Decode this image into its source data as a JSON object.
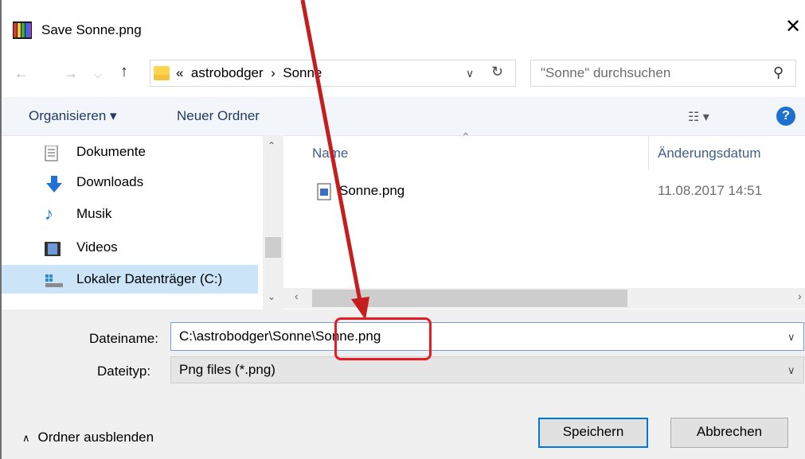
{
  "window": {
    "title": "Save Sonne.png",
    "close_icon": "close-icon"
  },
  "nav": {
    "back_icon": "arrow-left-icon",
    "forward_icon": "arrow-right-icon",
    "recent_icon": "chevron-down-icon",
    "up_icon": "arrow-up-icon",
    "address": {
      "prefix": "«",
      "path": [
        "astrobodger",
        "Sonne"
      ],
      "separator": "›"
    },
    "search_placeholder": "\"Sonne\" durchsuchen"
  },
  "toolbar": {
    "organize_label": "Organisieren ▾",
    "new_folder_label": "Neuer Ordner",
    "view_icon": "view-options-icon",
    "help_label": "?"
  },
  "sidebar": {
    "items": [
      {
        "label": "Dokumente",
        "icon": "documents-icon"
      },
      {
        "label": "Downloads",
        "icon": "downloads-icon"
      },
      {
        "label": "Musik",
        "icon": "music-icon"
      },
      {
        "label": "Videos",
        "icon": "videos-icon"
      },
      {
        "label": "Lokaler Datenträger (C:)",
        "icon": "drive-icon",
        "selected": true
      }
    ]
  },
  "file_list": {
    "columns": [
      "Name",
      "Änderungsdatum"
    ],
    "rows": [
      {
        "name": "Sonne.png",
        "modified": "11.08.2017 14:51",
        "icon": "png-file-icon"
      }
    ]
  },
  "form": {
    "filename_label": "Dateiname:",
    "filename_value": "C:\\astrobodger\\Sonne\\Sonne.png",
    "filetype_label": "Dateityp:",
    "filetype_value": "Png files (*.png)"
  },
  "footer": {
    "hide_folders_label": "Ordner ausblenden",
    "save_label": "Speichern",
    "cancel_label": "Abbrechen"
  },
  "annotation": {
    "highlight_color": "#e51c23",
    "arrow_color": "#c41e1e"
  },
  "colors": {
    "accent": "#0078d7",
    "selection": "#cce4f7",
    "toolbar_bg": "#f2f5fa"
  }
}
